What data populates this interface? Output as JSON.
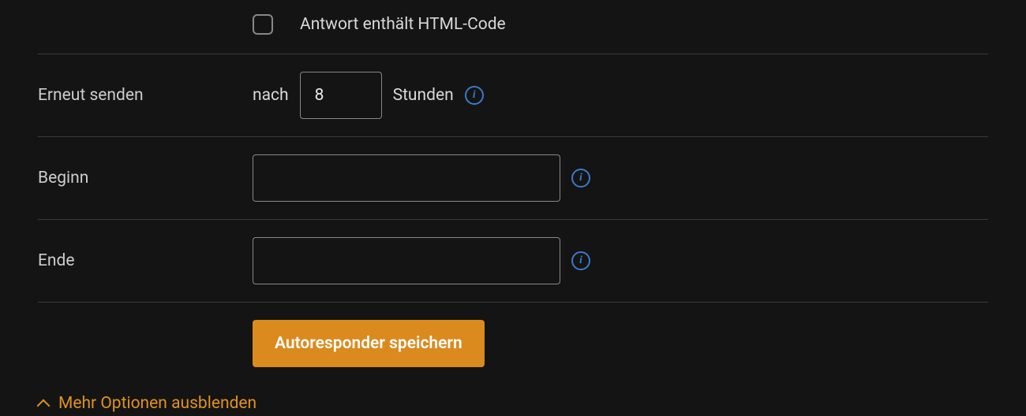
{
  "html_code": {
    "label": "Antwort enthält HTML-Code",
    "checked": false
  },
  "resend": {
    "label": "Erneut senden",
    "prefix": "nach",
    "value": "8",
    "suffix": "Stunden"
  },
  "begin": {
    "label": "Beginn",
    "value": ""
  },
  "end": {
    "label": "Ende",
    "value": ""
  },
  "actions": {
    "save": "Autoresponder speichern"
  },
  "toggle": {
    "label": "Mehr Optionen ausblenden"
  }
}
